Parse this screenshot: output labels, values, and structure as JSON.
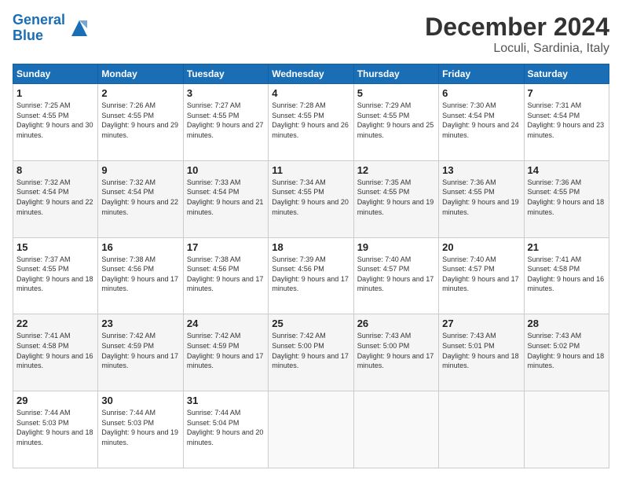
{
  "header": {
    "logo_line1": "General",
    "logo_line2": "Blue",
    "title": "December 2024",
    "location": "Loculi, Sardinia, Italy"
  },
  "days_of_week": [
    "Sunday",
    "Monday",
    "Tuesday",
    "Wednesday",
    "Thursday",
    "Friday",
    "Saturday"
  ],
  "weeks": [
    [
      {
        "day": "1",
        "sunrise": "7:25 AM",
        "sunset": "4:55 PM",
        "daylight": "9 hours and 30 minutes."
      },
      {
        "day": "2",
        "sunrise": "7:26 AM",
        "sunset": "4:55 PM",
        "daylight": "9 hours and 29 minutes."
      },
      {
        "day": "3",
        "sunrise": "7:27 AM",
        "sunset": "4:55 PM",
        "daylight": "9 hours and 27 minutes."
      },
      {
        "day": "4",
        "sunrise": "7:28 AM",
        "sunset": "4:55 PM",
        "daylight": "9 hours and 26 minutes."
      },
      {
        "day": "5",
        "sunrise": "7:29 AM",
        "sunset": "4:55 PM",
        "daylight": "9 hours and 25 minutes."
      },
      {
        "day": "6",
        "sunrise": "7:30 AM",
        "sunset": "4:54 PM",
        "daylight": "9 hours and 24 minutes."
      },
      {
        "day": "7",
        "sunrise": "7:31 AM",
        "sunset": "4:54 PM",
        "daylight": "9 hours and 23 minutes."
      }
    ],
    [
      {
        "day": "8",
        "sunrise": "7:32 AM",
        "sunset": "4:54 PM",
        "daylight": "9 hours and 22 minutes."
      },
      {
        "day": "9",
        "sunrise": "7:32 AM",
        "sunset": "4:54 PM",
        "daylight": "9 hours and 22 minutes."
      },
      {
        "day": "10",
        "sunrise": "7:33 AM",
        "sunset": "4:54 PM",
        "daylight": "9 hours and 21 minutes."
      },
      {
        "day": "11",
        "sunrise": "7:34 AM",
        "sunset": "4:55 PM",
        "daylight": "9 hours and 20 minutes."
      },
      {
        "day": "12",
        "sunrise": "7:35 AM",
        "sunset": "4:55 PM",
        "daylight": "9 hours and 19 minutes."
      },
      {
        "day": "13",
        "sunrise": "7:36 AM",
        "sunset": "4:55 PM",
        "daylight": "9 hours and 19 minutes."
      },
      {
        "day": "14",
        "sunrise": "7:36 AM",
        "sunset": "4:55 PM",
        "daylight": "9 hours and 18 minutes."
      }
    ],
    [
      {
        "day": "15",
        "sunrise": "7:37 AM",
        "sunset": "4:55 PM",
        "daylight": "9 hours and 18 minutes."
      },
      {
        "day": "16",
        "sunrise": "7:38 AM",
        "sunset": "4:56 PM",
        "daylight": "9 hours and 17 minutes."
      },
      {
        "day": "17",
        "sunrise": "7:38 AM",
        "sunset": "4:56 PM",
        "daylight": "9 hours and 17 minutes."
      },
      {
        "day": "18",
        "sunrise": "7:39 AM",
        "sunset": "4:56 PM",
        "daylight": "9 hours and 17 minutes."
      },
      {
        "day": "19",
        "sunrise": "7:40 AM",
        "sunset": "4:57 PM",
        "daylight": "9 hours and 17 minutes."
      },
      {
        "day": "20",
        "sunrise": "7:40 AM",
        "sunset": "4:57 PM",
        "daylight": "9 hours and 17 minutes."
      },
      {
        "day": "21",
        "sunrise": "7:41 AM",
        "sunset": "4:58 PM",
        "daylight": "9 hours and 16 minutes."
      }
    ],
    [
      {
        "day": "22",
        "sunrise": "7:41 AM",
        "sunset": "4:58 PM",
        "daylight": "9 hours and 16 minutes."
      },
      {
        "day": "23",
        "sunrise": "7:42 AM",
        "sunset": "4:59 PM",
        "daylight": "9 hours and 17 minutes."
      },
      {
        "day": "24",
        "sunrise": "7:42 AM",
        "sunset": "4:59 PM",
        "daylight": "9 hours and 17 minutes."
      },
      {
        "day": "25",
        "sunrise": "7:42 AM",
        "sunset": "5:00 PM",
        "daylight": "9 hours and 17 minutes."
      },
      {
        "day": "26",
        "sunrise": "7:43 AM",
        "sunset": "5:00 PM",
        "daylight": "9 hours and 17 minutes."
      },
      {
        "day": "27",
        "sunrise": "7:43 AM",
        "sunset": "5:01 PM",
        "daylight": "9 hours and 18 minutes."
      },
      {
        "day": "28",
        "sunrise": "7:43 AM",
        "sunset": "5:02 PM",
        "daylight": "9 hours and 18 minutes."
      }
    ],
    [
      {
        "day": "29",
        "sunrise": "7:44 AM",
        "sunset": "5:03 PM",
        "daylight": "9 hours and 18 minutes."
      },
      {
        "day": "30",
        "sunrise": "7:44 AM",
        "sunset": "5:03 PM",
        "daylight": "9 hours and 19 minutes."
      },
      {
        "day": "31",
        "sunrise": "7:44 AM",
        "sunset": "5:04 PM",
        "daylight": "9 hours and 20 minutes."
      },
      null,
      null,
      null,
      null
    ]
  ]
}
